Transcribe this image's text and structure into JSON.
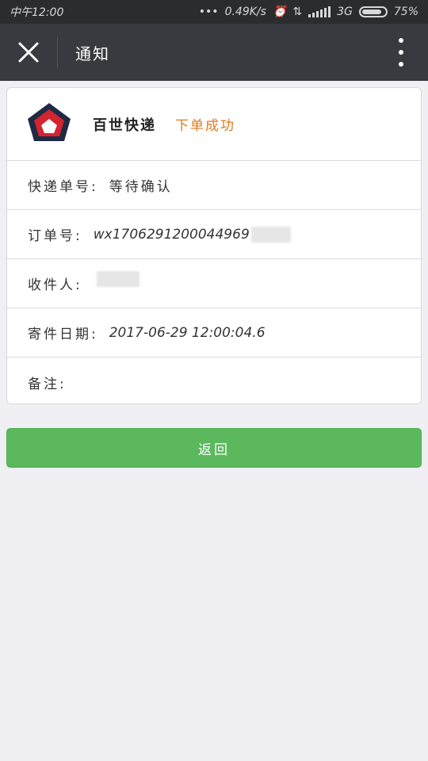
{
  "status_bar": {
    "time": "中午12:00",
    "network_speed": "0.49K/s",
    "network_type": "3G",
    "battery": "75%"
  },
  "nav": {
    "title": "通知"
  },
  "card": {
    "company": "百世快递",
    "order_status": "下单成功",
    "rows": [
      {
        "label": "快递单号:",
        "value": "等待确认"
      },
      {
        "label": "订单号:",
        "value": "wx1706291200044969"
      },
      {
        "label": "收件人:",
        "value": ""
      },
      {
        "label": "寄件日期:",
        "value": "2017-06-29 12:00:04.6"
      },
      {
        "label": "备注:",
        "value": ""
      }
    ]
  },
  "button": {
    "return_label": "返回"
  },
  "colors": {
    "status_orange": "#e07a1a",
    "button_green": "#5cb85c",
    "nav_dark": "#393a3f",
    "logo_red": "#d3242f",
    "logo_navy": "#1f2a44"
  }
}
